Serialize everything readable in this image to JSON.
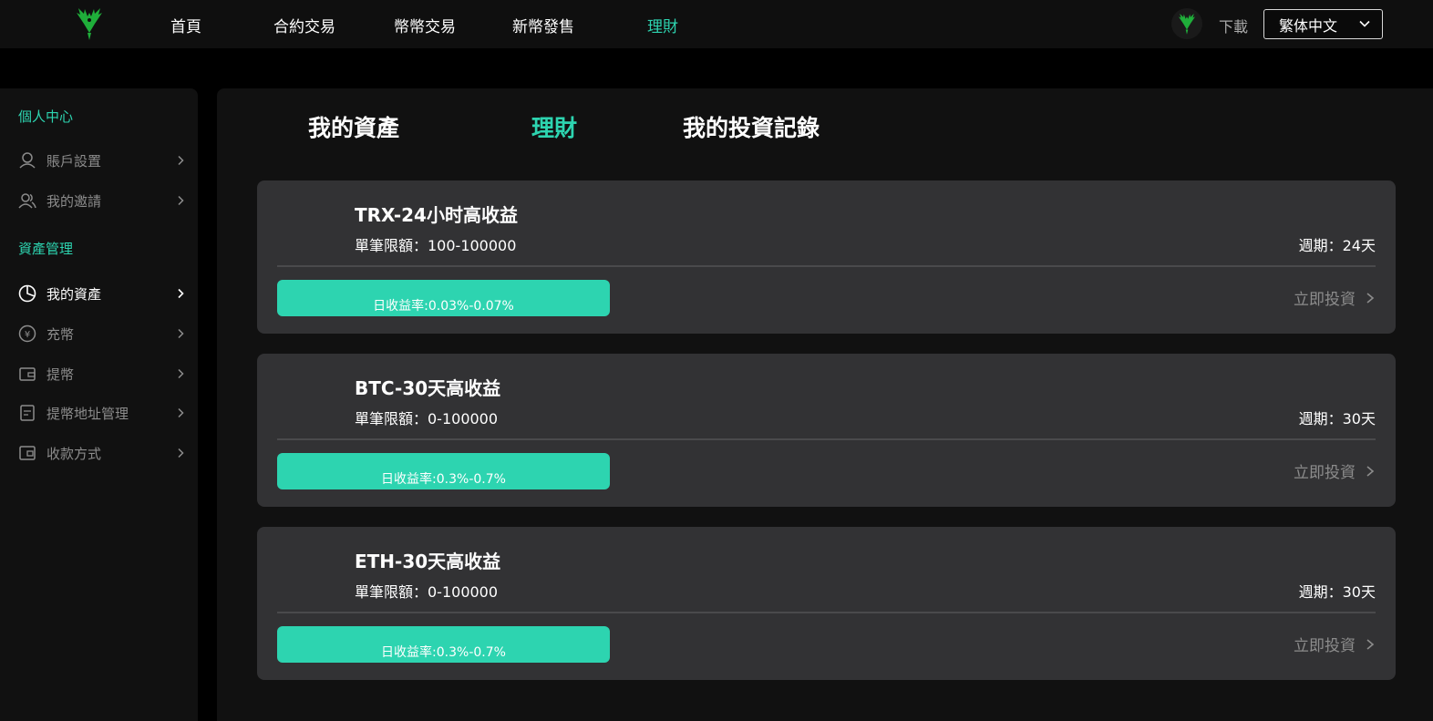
{
  "nav": {
    "items": [
      "首頁",
      "合約交易",
      "幣幣交易",
      "新幣發售",
      "理財"
    ],
    "active_index": 4,
    "download": "下載",
    "language": "繁体中文"
  },
  "sidebar": {
    "section1": "個人中心",
    "section1_items": [
      "賬戶設置",
      "我的邀請"
    ],
    "section2": "資產管理",
    "section2_items": [
      "我的資產",
      "充幣",
      "提幣",
      "提幣地址管理",
      "收款方式"
    ],
    "active_item": "我的資產"
  },
  "tabs": [
    "我的資產",
    "理財",
    "我的投資記錄"
  ],
  "active_tab": 1,
  "products": [
    {
      "title": "TRX-24小时高收益",
      "limit": "單筆限額：100-100000",
      "period": "週期：24天",
      "rate": "日收益率:0.03%-0.07%",
      "cta": "立即投資"
    },
    {
      "title": "BTC-30天高收益",
      "limit": "單筆限額：0-100000",
      "period": "週期：30天",
      "rate": "日收益率:0.3%-0.7%",
      "cta": "立即投資"
    },
    {
      "title": "ETH-30天高收益",
      "limit": "單筆限額：0-100000",
      "period": "週期：30天",
      "rate": "日收益率:0.3%-0.7%",
      "cta": "立即投資"
    }
  ],
  "colors": {
    "accent": "#2dd4b0",
    "card": "#323234",
    "logo": "#1fae3a"
  },
  "icons": {
    "logo": "phoenix-logo-icon",
    "sidebar": [
      "user-icon",
      "users-icon",
      "pie-chart-icon",
      "yen-coin-icon",
      "wallet-icon",
      "address-book-icon",
      "card-wallet-icon"
    ]
  }
}
